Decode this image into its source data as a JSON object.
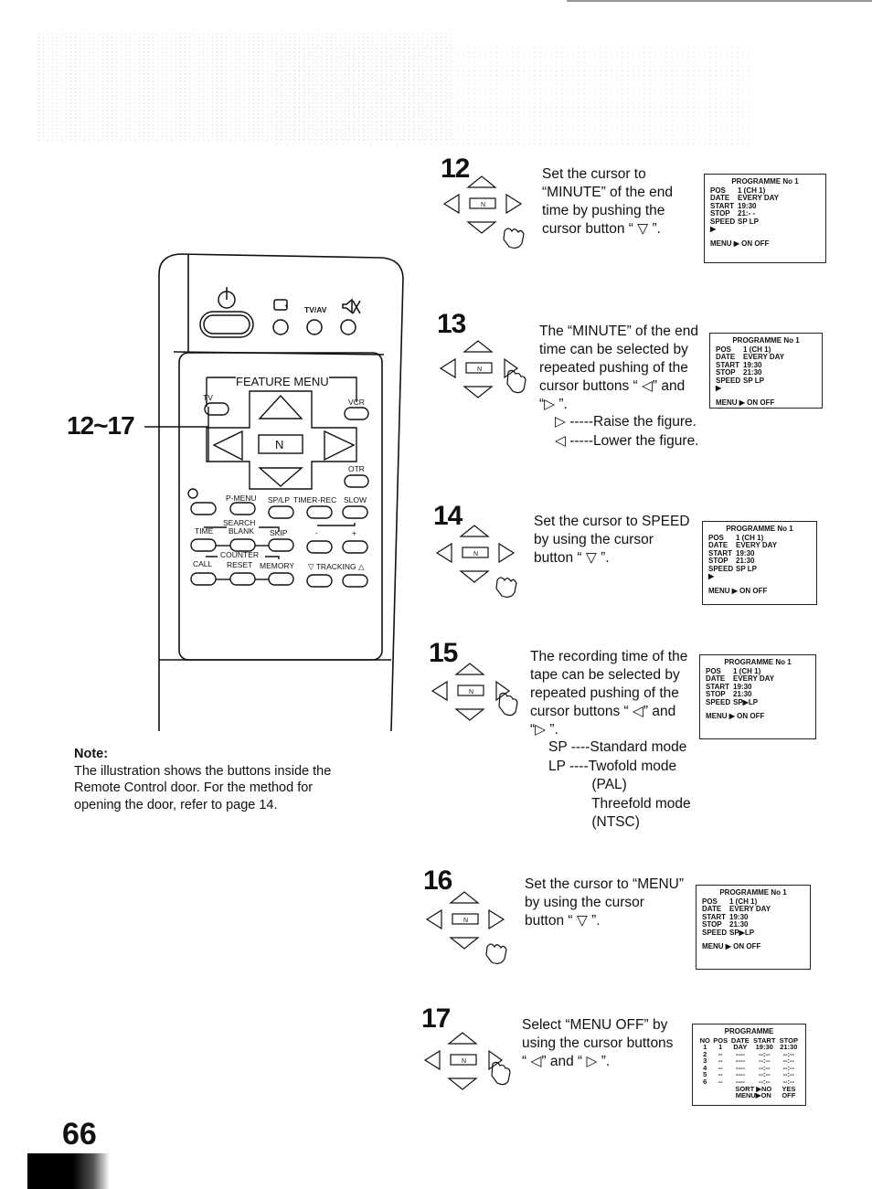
{
  "page": {
    "number": "66"
  },
  "callout": "12~17",
  "remote": {
    "top_buttons": {
      "tv_av": "TV/AV"
    },
    "feature_menu": "FEATURE MENU",
    "labels": {
      "tv": "TV",
      "vcr": "VCR",
      "otr": "OTR",
      "center": "N"
    },
    "row1": [
      "P-MENU",
      "SP/LP",
      "TIMER-REC",
      "SLOW"
    ],
    "search_group": "SEARCH",
    "row2": [
      "TIME",
      "BLANK",
      "SKIP"
    ],
    "plus_minus": [
      "-",
      "+"
    ],
    "counter_group": "COUNTER",
    "row3": [
      "CALL",
      "RESET",
      "MEMORY"
    ],
    "tracking": "▽ TRACKING △"
  },
  "note": {
    "heading": "Note:",
    "lines": [
      "The illustration shows the buttons inside the",
      "Remote Control door. For the method for",
      "opening the door, refer to page 14."
    ]
  },
  "steps": [
    {
      "num": "12",
      "pressed": "down",
      "lines": [
        "Set the cursor to",
        "“MINUTE” of the end",
        "time by pushing the",
        "cursor button “ ▽ ”."
      ],
      "osd": {
        "title": "PROGRAMME No 1",
        "rows": [
          [
            "POS",
            "1 (CH 1)"
          ],
          [
            "DATE",
            "EVERY DAY"
          ],
          [
            "START",
            "19:30"
          ],
          [
            "STOP",
            "21:- -"
          ],
          [
            "SPEED ▶",
            "SP  LP"
          ]
        ],
        "menu": "MENU  ▶ ON OFF"
      }
    },
    {
      "num": "13",
      "pressed": "right",
      "lines": [
        "The “MINUTE” of the end",
        "time can be selected by",
        "repeated pushing of the",
        "cursor buttons “ ◁” and",
        "“▷ ”."
      ],
      "sub": [
        "▷ -----Raise the figure.",
        "◁ -----Lower the figure."
      ],
      "osd": {
        "title": "PROGRAMME No 1",
        "rows": [
          [
            "POS",
            "1 (CH 1)"
          ],
          [
            "DATE",
            "EVERY DAY"
          ],
          [
            "START",
            "19:30"
          ],
          [
            "STOP",
            "21:30"
          ],
          [
            "SPEED ▶",
            "SP  LP"
          ]
        ],
        "menu": "MENU  ▶ ON OFF"
      }
    },
    {
      "num": "14",
      "pressed": "down",
      "lines": [
        "Set the cursor to SPEED",
        "by using the cursor",
        "button “ ▽ ”."
      ],
      "osd": {
        "title": "PROGRAMME No 1",
        "rows": [
          [
            "POS",
            "1 (CH 1)"
          ],
          [
            "DATE",
            "EVERY DAY"
          ],
          [
            "START",
            "19:30"
          ],
          [
            "STOP",
            "21:30"
          ],
          [
            "SPEED ▶",
            "SP  LP"
          ]
        ],
        "menu": "MENU  ▶ ON OFF"
      }
    },
    {
      "num": "15",
      "pressed": "right",
      "lines": [
        "The recording time of the",
        "tape can be selected by",
        "repeated pushing of the",
        "cursor buttons “ ◁” and",
        "“▷ ”."
      ],
      "sub": [
        "SP ----Standard mode",
        "LP ----Twofold mode",
        "           (PAL)",
        "           Threefold mode",
        "           (NTSC)"
      ],
      "osd": {
        "title": "PROGRAMME No 1",
        "rows": [
          [
            "POS",
            "1 (CH 1)"
          ],
          [
            "DATE",
            "EVERY DAY"
          ],
          [
            "START",
            "19:30"
          ],
          [
            "STOP",
            "21:30"
          ],
          [
            "SPEED",
            "SP▶LP"
          ]
        ],
        "menu": "MENU  ▶ ON OFF"
      }
    },
    {
      "num": "16",
      "pressed": "down",
      "lines": [
        "Set the cursor to “MENU”",
        "by using the cursor",
        "button “ ▽ ”."
      ],
      "osd": {
        "title": "PROGRAMME No 1",
        "rows": [
          [
            "POS",
            "1 (CH 1)"
          ],
          [
            "DATE",
            "EVERY DAY"
          ],
          [
            "START",
            "19:30"
          ],
          [
            "STOP",
            "21:30"
          ],
          [
            "SPEED",
            "SP▶LP"
          ]
        ],
        "menu": "MENU  ▶ ON OFF"
      }
    },
    {
      "num": "17",
      "pressed": "right",
      "lines": [
        "Select “MENU OFF” by",
        "using the cursor buttons",
        "“ ◁” and “ ▷ ”."
      ],
      "osd_list": {
        "title": "PROGRAMME",
        "headers": [
          "NO",
          "POS",
          "DATE",
          "START",
          "STOP"
        ],
        "rows": [
          [
            "1",
            "1",
            "DAY",
            "19:30",
            "21:30"
          ],
          [
            "2",
            "--",
            "----",
            "--:--",
            "--:--"
          ],
          [
            "3",
            "--",
            "----",
            "--:--",
            "--:--"
          ],
          [
            "4",
            "--",
            "----",
            "--:--",
            "--:--"
          ],
          [
            "5",
            "--",
            "----",
            "--:--",
            "--:--"
          ],
          [
            "6",
            "--",
            "----",
            "--:--",
            "--:--"
          ]
        ],
        "footer": [
          [
            "SORT ▶NO",
            "YES"
          ],
          [
            "MENU▶ON",
            "OFF"
          ]
        ]
      }
    }
  ]
}
